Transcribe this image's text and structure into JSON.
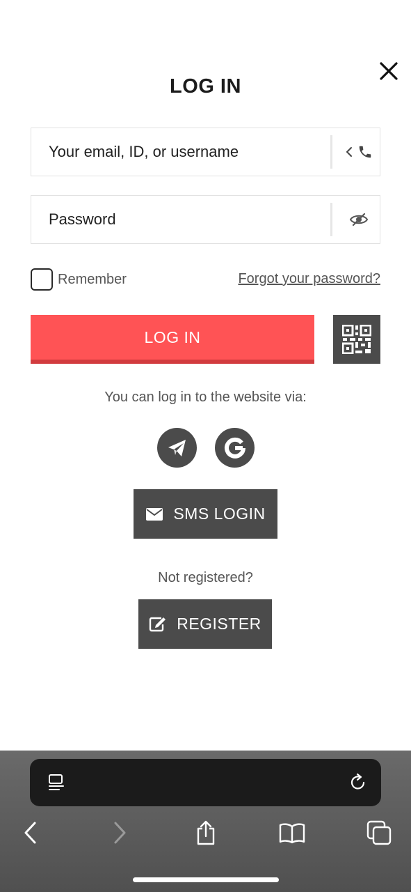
{
  "modal": {
    "title": "LOG IN",
    "close_icon": "close-icon"
  },
  "form": {
    "email_placeholder": "Your email, ID, or username",
    "password_placeholder": "Password",
    "remember_label": "Remember",
    "remember_checked": false,
    "forgot_link": "Forgot your password?",
    "login_button": "LOG IN"
  },
  "alt_login": {
    "via_text": "You can log in to the website via:",
    "providers": [
      {
        "name": "Telegram",
        "icon": "telegram-icon"
      },
      {
        "name": "Google",
        "icon": "google-icon"
      }
    ],
    "sms_button": "SMS LOGIN",
    "not_registered": "Not registered?",
    "register_button": "REGISTER"
  },
  "colors": {
    "primary": "#ff5355",
    "primary_border": "#d23b3e",
    "dark_button": "#4b4b4b"
  },
  "browser": {
    "icons": [
      "reader-icon",
      "reload-icon",
      "back-icon",
      "forward-icon",
      "share-icon",
      "bookmarks-icon",
      "tabs-icon"
    ]
  }
}
